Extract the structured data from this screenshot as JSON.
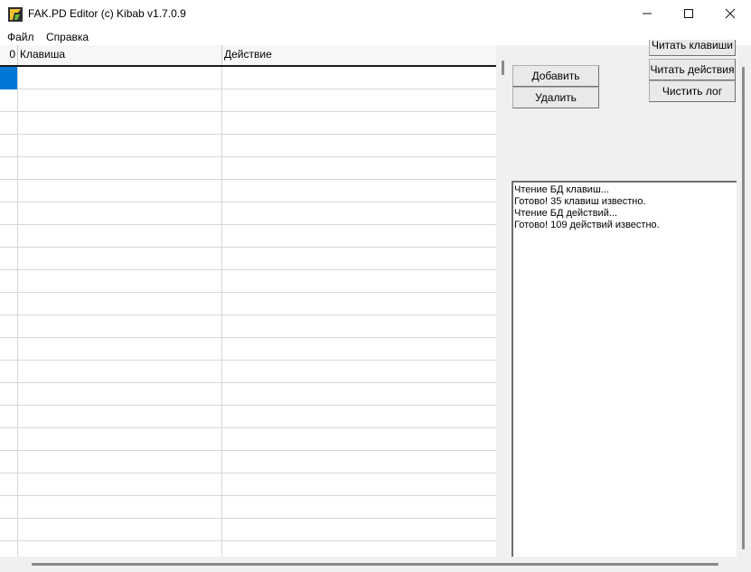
{
  "window": {
    "title": "FAK.PD Editor (c) Kibab v1.7.0.9",
    "controls": [
      "minimize-icon",
      "maximize-icon",
      "close-icon"
    ]
  },
  "menu": {
    "items": [
      {
        "label": "Файл"
      },
      {
        "label": "Справка"
      }
    ]
  },
  "grid": {
    "columns": [
      {
        "label": "0"
      },
      {
        "label": "Клавиша"
      },
      {
        "label": "Действие"
      }
    ],
    "selected_row": 0,
    "selection_color": "#0078d7"
  },
  "buttons": {
    "add": "Добавить",
    "delete": "Удалить",
    "read_keys": "Читать клавиши",
    "read_actions": "Читать действия",
    "clear_log": "Чистить лог"
  },
  "log": {
    "lines": [
      "Чтение БД клавиш...",
      "Готово! 35 клавиш известно.",
      "Чтение БД действий...",
      "Готово! 109 действий известно."
    ]
  }
}
